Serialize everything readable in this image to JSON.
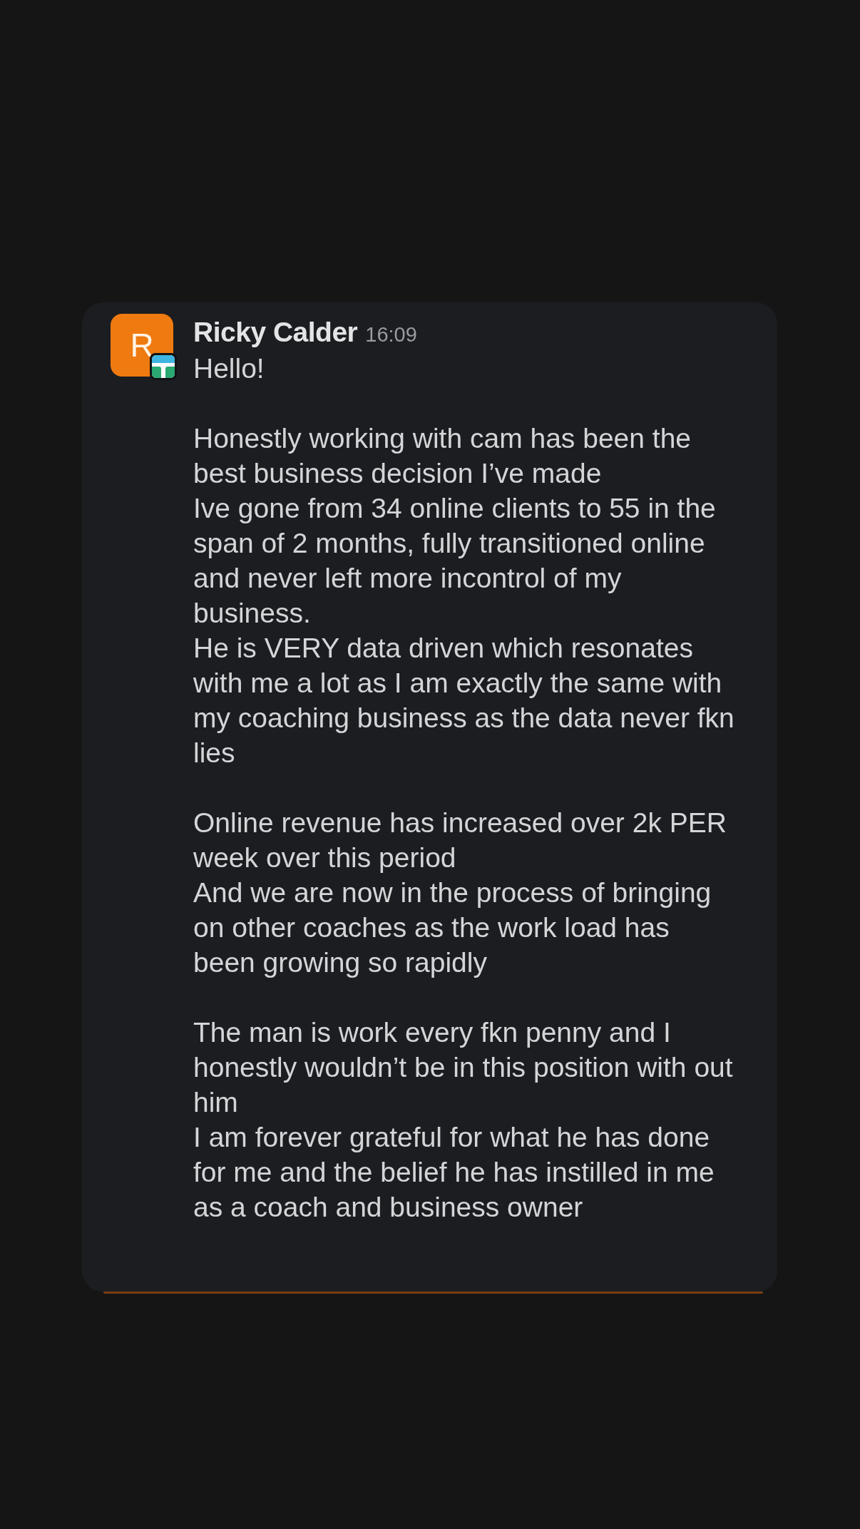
{
  "message": {
    "avatar_initial": "R",
    "app_badge": true,
    "author": "Ricky Calder",
    "time": "16:09",
    "paragraphs": [
      "Hello!",
      "Honestly working with cam has been the best business decision I’ve made\nIve gone from 34 online clients to 55 in the span of 2 months, fully transitioned online and never left more incontrol of my business.\nHe is VERY data driven which resonates with me a lot as I am exactly the same with my coaching business as the data never fkn lies",
      "Online revenue has increased over 2k PER week over this period\nAnd we are now in the process of bringing on other coaches as the work load has been growing so rapidly",
      "The man is work every fkn penny and I honestly wouldn’t be in this position with out him\nI am forever grateful for what he has done for me and the belief he has instilled in me as a coach and business owner"
    ]
  }
}
